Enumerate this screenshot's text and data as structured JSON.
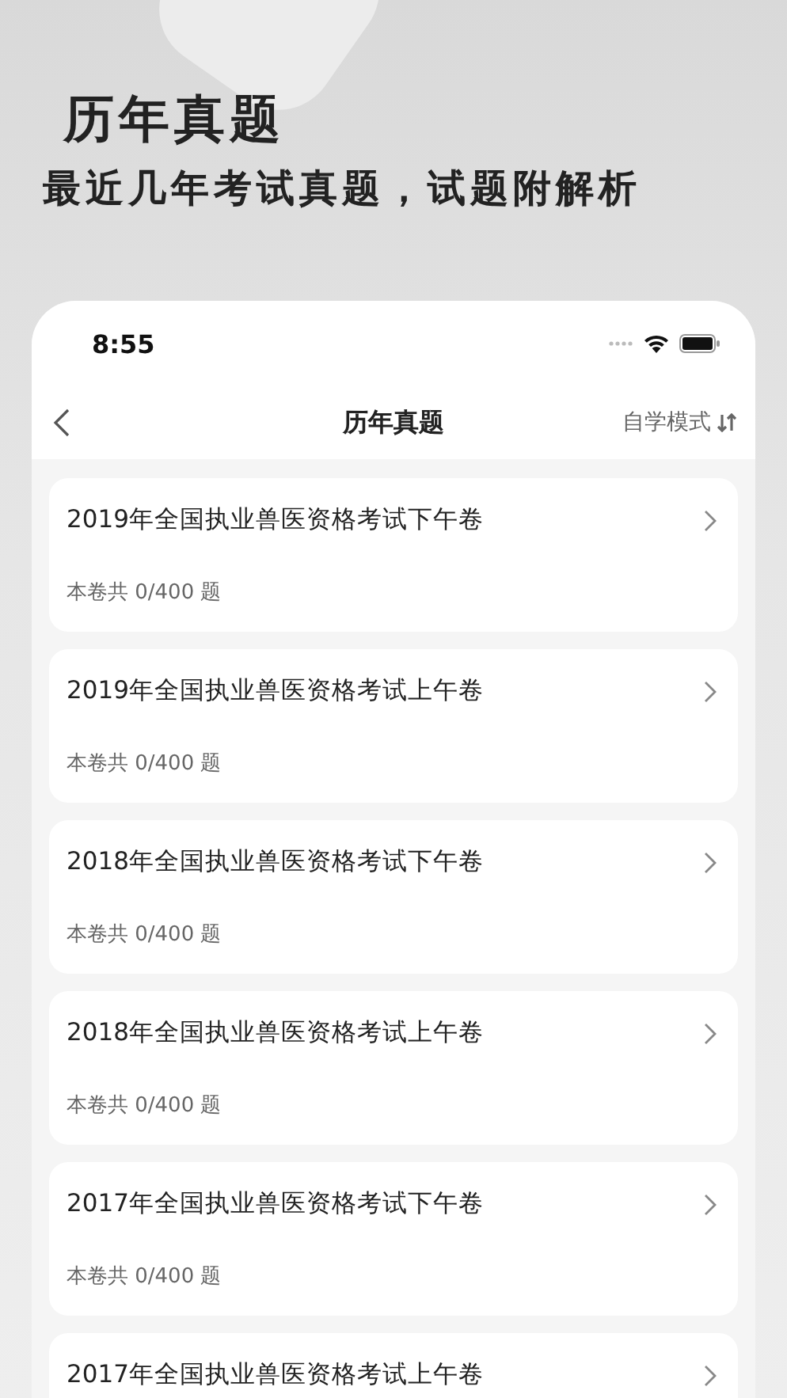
{
  "promo": {
    "title": "历年真题",
    "subtitle": "最近几年考试真题，试题附解析"
  },
  "status_bar": {
    "time": "8:55"
  },
  "nav": {
    "title": "历年真题",
    "mode": "自学模式"
  },
  "papers": [
    {
      "title": "2019年全国执业兽医资格考试下午卷",
      "count": "本卷共 0/400 题"
    },
    {
      "title": "2019年全国执业兽医资格考试上午卷",
      "count": "本卷共 0/400 题"
    },
    {
      "title": "2018年全国执业兽医资格考试下午卷",
      "count": "本卷共 0/400 题"
    },
    {
      "title": "2018年全国执业兽医资格考试上午卷",
      "count": "本卷共 0/400 题"
    },
    {
      "title": "2017年全国执业兽医资格考试下午卷",
      "count": "本卷共 0/400 题"
    },
    {
      "title": "2017年全国执业兽医资格考试上午卷"
    }
  ]
}
